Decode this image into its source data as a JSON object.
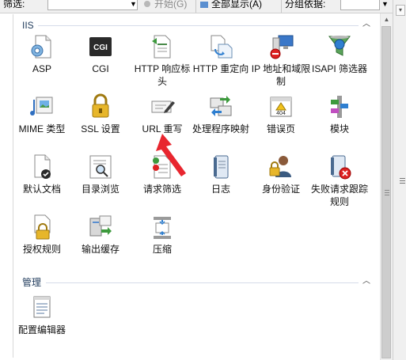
{
  "toolbar": {
    "filter_label": "筛选:",
    "start_label": "开始(G)",
    "show_all_label": "全部显示(A)",
    "group_by_label": "分组依据:"
  },
  "groups": [
    {
      "title": "IIS",
      "items": [
        {
          "label": "ASP",
          "icon": "asp-icon"
        },
        {
          "label": "CGI",
          "icon": "cgi-icon"
        },
        {
          "label": "HTTP 响应标头",
          "icon": "http-response-headers-icon"
        },
        {
          "label": "HTTP 重定向",
          "icon": "http-redirect-icon"
        },
        {
          "label": "IP 地址和域限制",
          "icon": "ip-domain-restrictions-icon"
        },
        {
          "label": "ISAPI 筛选器",
          "icon": "isapi-filters-icon"
        },
        {
          "label": "MIME 类型",
          "icon": "mime-types-icon"
        },
        {
          "label": "SSL 设置",
          "icon": "ssl-settings-icon"
        },
        {
          "label": "URL 重写",
          "icon": "url-rewrite-icon"
        },
        {
          "label": "处理程序映射",
          "icon": "handler-mappings-icon"
        },
        {
          "label": "错误页",
          "icon": "error-pages-icon"
        },
        {
          "label": "模块",
          "icon": "modules-icon"
        },
        {
          "label": "默认文档",
          "icon": "default-document-icon"
        },
        {
          "label": "目录浏览",
          "icon": "directory-browsing-icon"
        },
        {
          "label": "请求筛选",
          "icon": "request-filtering-icon"
        },
        {
          "label": "日志",
          "icon": "logging-icon"
        },
        {
          "label": "身份验证",
          "icon": "authentication-icon"
        },
        {
          "label": "失败请求跟踪规则",
          "icon": "failed-request-tracing-icon"
        },
        {
          "label": "授权规则",
          "icon": "authorization-rules-icon"
        },
        {
          "label": "输出缓存",
          "icon": "output-caching-icon"
        },
        {
          "label": "压缩",
          "icon": "compression-icon"
        }
      ]
    },
    {
      "title": "管理",
      "items": [
        {
          "label": "配置编辑器",
          "icon": "configuration-editor-icon"
        }
      ]
    }
  ],
  "colors": {
    "annotation_arrow": "#e8262f",
    "group_header": "#1e395b",
    "toolbar_bg": "#f0f0f0"
  }
}
